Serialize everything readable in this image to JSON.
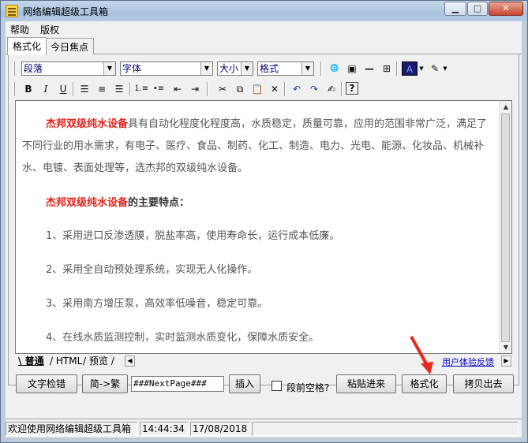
{
  "window": {
    "title": "网络编辑超级工具箱"
  },
  "menu": {
    "items": [
      "帮助",
      "版权"
    ]
  },
  "tabs": {
    "items": [
      "格式化",
      "今日焦点"
    ]
  },
  "toolbar": {
    "paragraph_select": "段落",
    "font_select": "字体",
    "size_select": "大小",
    "format_select": "格式"
  },
  "editor": {
    "p1_highlight": "杰邦双级纯水设备",
    "p1_rest": "具有自动化程度化程度高，水质稳定，质量可靠，应用的范围非常广泛，满足了不同行业的用水需求，有电子、医疗、食品、制药、化工、制造、电力、光电、能源、化妆品、机械补水、电镀、表面处理等，选杰邦的双级纯水设备。",
    "p2_highlight": "杰邦双级纯水设备",
    "p2_rest": "的主要特点：",
    "items": [
      "1、采用进口反渗透膜，脱盐率高，使用寿命长，运行成本低廉。",
      "2、采用全自动预处理系统，实现无人化操作。",
      "3、采用南方增压泵，高效率低噪音，稳定可靠。",
      "4、在线水质监测控制，实时监测水质变化，保障水质安全。"
    ]
  },
  "view_tabs": {
    "normal": "普通",
    "html": "HTML",
    "preview": "预览",
    "feedback_link": "用户体验反馈"
  },
  "buttons": {
    "text_check": "文字检错",
    "simp_trad": "简->繁",
    "next_page_value": "###NextPage###",
    "insert": "插入",
    "space_before_para": "段前空格?",
    "paste_in": "粘贴进来",
    "format": "格式化",
    "copy_out": "拷贝出去"
  },
  "status": {
    "welcome": "欢迎使用网络编辑超级工具箱",
    "time": "14:44:34",
    "date": "17/08/2018"
  },
  "colors": {
    "highlight_red": "#e0231a",
    "link_blue": "#0000c8",
    "annotation_arrow": "#e8281c"
  }
}
